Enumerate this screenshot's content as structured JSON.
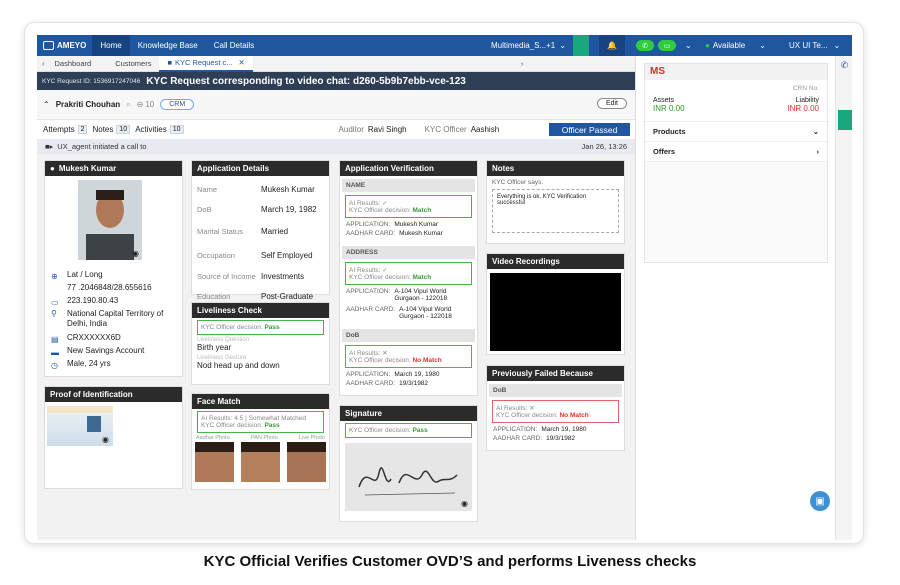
{
  "topbar": {
    "brand": "AMEYO",
    "nav": [
      "Home",
      "Knowledge Base",
      "Call Details"
    ],
    "multimedia": "Multimedia_S...+1",
    "status": "Available",
    "user": "UX UI Te..."
  },
  "tabs": {
    "dashboard": "Dashboard",
    "customers": "Customers",
    "kyc": "KYC Request c..."
  },
  "request": {
    "id": "KYC Request ID: 1536917247046",
    "title": "KYC Request corresponding to video chat: d260-5b9b7ebb-vce-123"
  },
  "customer": {
    "name": "Prakriti Chouhan",
    "count": "10",
    "crm": "CRM",
    "edit": "Edit"
  },
  "stats": {
    "attempts_label": "Attempts",
    "attempts": "2",
    "notes_label": "Notes",
    "notes": "10",
    "activities_label": "Activities",
    "activities": "10",
    "auditor_label": "Auditor",
    "auditor": "Ravi Singh",
    "officer_label": "KYC Officer",
    "officer": "Aashish",
    "passed": "Officer Passed"
  },
  "log": {
    "text": "UX_agent initiated a call to",
    "time": "Jan 26, 13:26"
  },
  "profile": {
    "name": "Mukesh Kumar",
    "latlong_label": "Lat / Long",
    "latlong": "77 .2046848/28.655616",
    "ip": "223.190.80.43",
    "location": "National Capital Territory of Delhi, India",
    "account_no": "CRXXXXXX6D",
    "account_type": "New Savings Account",
    "gender_age": "Male, 24 yrs"
  },
  "proof": {
    "title": "Proof of Identification"
  },
  "application": {
    "title": "Application Details",
    "rows": [
      {
        "label": "Name",
        "value": "Mukesh Kumar"
      },
      {
        "label": "DoB",
        "value": "March 19, 1982"
      },
      {
        "label": "Marital Status",
        "value": "Married"
      },
      {
        "label": "Occupation",
        "value": "Self Employed"
      },
      {
        "label": "Source of Income",
        "value": "Investments"
      },
      {
        "label": "Education",
        "value": "Post-Graduate"
      }
    ]
  },
  "liveliness": {
    "title": "Liveliness Check",
    "decision_label": "KYC Officer decision:",
    "decision": "Pass",
    "q_label": "Liveliness Question",
    "question": "Birth year",
    "g_label": "Liveliness Gesture",
    "gesture": "Nod head up and down"
  },
  "facematch": {
    "title": "Face Match",
    "ai": "AI Results: 4.5 | Somewhat Matched",
    "decision_label": "KYC Officer decision:",
    "decision": "Pass",
    "photos": [
      "Aadhar Photo",
      "PAN Photo",
      "Live Photo"
    ]
  },
  "verification": {
    "title": "Application Verification",
    "name": {
      "head": "NAME",
      "ai": "AI Results: ✓",
      "decision_label": "KYC Officer decision:",
      "decision": "Match",
      "app_label": "APPLICATION:",
      "app": "Mukesh Kumar",
      "aadhar_label": "AADHAR CARD:",
      "aadhar": "Mukesh Kumar"
    },
    "address": {
      "head": "ADDRESS",
      "ai": "AI Results: ✓",
      "decision_label": "KYC Officer decision:",
      "decision": "Match",
      "app_label": "APPLICATION:",
      "app": "A-104 Vipul World Gurgaon - 122018",
      "aadhar_label": "AADHAR CARD:",
      "aadhar": "A-104 Vipul World Gurgaon - 122018"
    },
    "dob": {
      "head": "DoB",
      "ai": "AI Results: ✕",
      "decision_label": "KYC Officer decision:",
      "decision": "No Match",
      "app_label": "APPLICATION:",
      "app": "March 19, 1980",
      "aadhar_label": "AADHAR CARD:",
      "aadhar": "19/3/1982"
    }
  },
  "signature": {
    "title": "Signature",
    "decision_label": "KYC Officer decision:",
    "decision": "Pass"
  },
  "notes": {
    "title": "Notes",
    "says": "KYC Officer says:",
    "text": "Everything is ok. KYC Verification successful"
  },
  "video": {
    "title": "Video Recordings"
  },
  "failed": {
    "title": "Previously Failed Because",
    "head": "DoB",
    "ai": "AI Results: ✕",
    "decision_label": "KYC Officer decision:",
    "decision": "No Match",
    "app_label": "APPLICATION:",
    "app": "March 19, 1980",
    "aadhar_label": "AADHAR CARD:",
    "aadhar": "19/3/1982"
  },
  "crm": {
    "logo": "MS",
    "crn": "CRN No.",
    "assets_label": "Assets",
    "assets": "INR 0.00",
    "liability_label": "Liability",
    "liability": "INR 0.00",
    "products": "Products",
    "offers": "Offers"
  },
  "caption": "KYC Official Verifies Customer OVD’S and performs Liveness checks"
}
